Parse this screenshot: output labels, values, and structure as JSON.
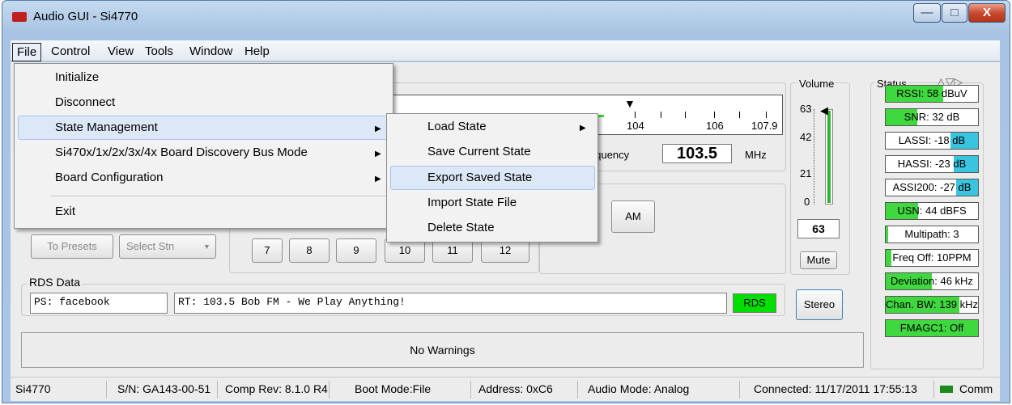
{
  "window": {
    "title": "Audio GUI - Si4770",
    "min": "—",
    "max": "□",
    "close": "X"
  },
  "menubar": [
    "File",
    "Control",
    "View",
    "Tools",
    "Window",
    "Help"
  ],
  "file_menu": {
    "items": [
      "Initialize",
      "Disconnect",
      "State Management",
      "Si470x/1x/2x/3x/4x Board Discovery Bus Mode",
      "Board Configuration",
      "Exit"
    ]
  },
  "state_submenu": {
    "items": [
      "Load State",
      "Save Current State",
      "Export Saved State",
      "Import State File",
      "Delete State"
    ]
  },
  "tuner": {
    "ticks": [
      "104",
      "106",
      "107.9"
    ],
    "frequency_label": "equency",
    "frequency_value": "103.5",
    "unit": "MHz",
    "am_button": "AM"
  },
  "presets": {
    "to_presets": "To Presets",
    "select_station": "Select Stn",
    "buttons": [
      "7",
      "8",
      "9",
      "10",
      "11",
      "12"
    ]
  },
  "rds": {
    "group_label": "RDS Data",
    "ps": "PS: facebook",
    "rt": "RT: 103.5 Bob FM - We Play Anything!",
    "indicator": "RDS"
  },
  "warnings": "No Warnings",
  "volume": {
    "label": "Volume",
    "ticks": [
      "63",
      "42",
      "21",
      "0"
    ],
    "value": "63",
    "level": 1.0,
    "mute": "Mute",
    "stereo": "Stereo"
  },
  "status": {
    "label": "Status",
    "arrows": "△▽▷",
    "items": [
      {
        "text": "RSSI: 58 dBuV",
        "fill": 0.62,
        "color": "#3fd83f"
      },
      {
        "text": "SNR: 32 dB",
        "fill": 0.34,
        "color": "#3fd83f"
      },
      {
        "text": "LASSI: -18 dB",
        "fill": 0.3,
        "color": "#39c4e0",
        "right": true
      },
      {
        "text": "HASSI: -23 dB",
        "fill": 0.26,
        "color": "#39c4e0",
        "right": true
      },
      {
        "text": "ASSI200: -27 dB",
        "fill": 0.24,
        "color": "#39c4e0",
        "right": true
      },
      {
        "text": "USN: 44 dBFS",
        "fill": 0.35,
        "color": "#3fd83f"
      },
      {
        "text": "Multipath: 3",
        "fill": 0.03,
        "color": "#3fd83f"
      },
      {
        "text": "Freq Off: 10PPM",
        "fill": 0.06,
        "color": "#3fd83f"
      },
      {
        "text": "Deviation: 46 kHz",
        "fill": 0.5,
        "color": "#3fd83f"
      },
      {
        "text": "Chan. BW: 139 kHz",
        "fill": 0.8,
        "color": "#3fd83f"
      },
      {
        "text": "FMAGC1: Off",
        "fill": 1.0,
        "color": "#3fd83f"
      }
    ]
  },
  "statusbar": {
    "device": "Si4770",
    "serial": "S/N: GA143-00-51",
    "comp_rev": "Comp Rev: 8.1.0 R4",
    "boot_mode": "Boot Mode:File",
    "address": "Address: 0xC6",
    "audio_mode": "Audio Mode: Analog",
    "connected": "Connected: 11/17/2011 17:55:13",
    "comm": "Comm"
  },
  "colors": {
    "accent_green": "#00dd00",
    "highlight": "#dce8f8",
    "status_cyan": "#39c4e0"
  }
}
